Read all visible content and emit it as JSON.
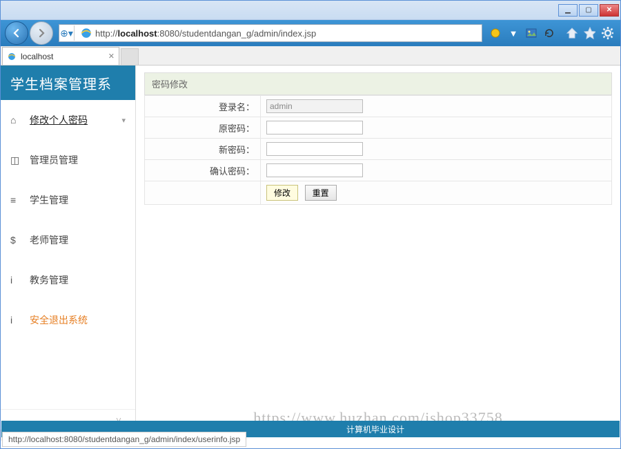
{
  "window": {
    "tab_title": "localhost",
    "address_display": "http://localhost:8080/studentdangan_g/admin/index.jsp",
    "address_prefix": "http://",
    "address_host": "localhost",
    "address_rest": ":8080/studentdangan_g/admin/index.jsp"
  },
  "brand": "学生档案管理系",
  "sidebar": {
    "items": [
      {
        "label": "修改个人密码",
        "icon": "home"
      },
      {
        "label": "管理员管理",
        "icon": "box"
      },
      {
        "label": "学生管理",
        "icon": "list"
      },
      {
        "label": "老师管理",
        "icon": "dollar"
      },
      {
        "label": "教务管理",
        "icon": "info"
      },
      {
        "label": "安全退出系统",
        "icon": "info"
      }
    ]
  },
  "panel": {
    "title": "密码修改",
    "rows": {
      "login_label": "登录名：",
      "login_value": "admin",
      "old_label": "原密码：",
      "new_label": "新密码：",
      "confirm_label": "确认密码："
    },
    "buttons": {
      "submit": "修改",
      "reset": "重置"
    }
  },
  "footer": {
    "credit": "计算机毕业设计"
  },
  "status": {
    "url": "http://localhost:8080/studentdangan_g/admin/index/userinfo.jsp"
  },
  "watermark": "https://www.huzhan.com/ishop33758"
}
